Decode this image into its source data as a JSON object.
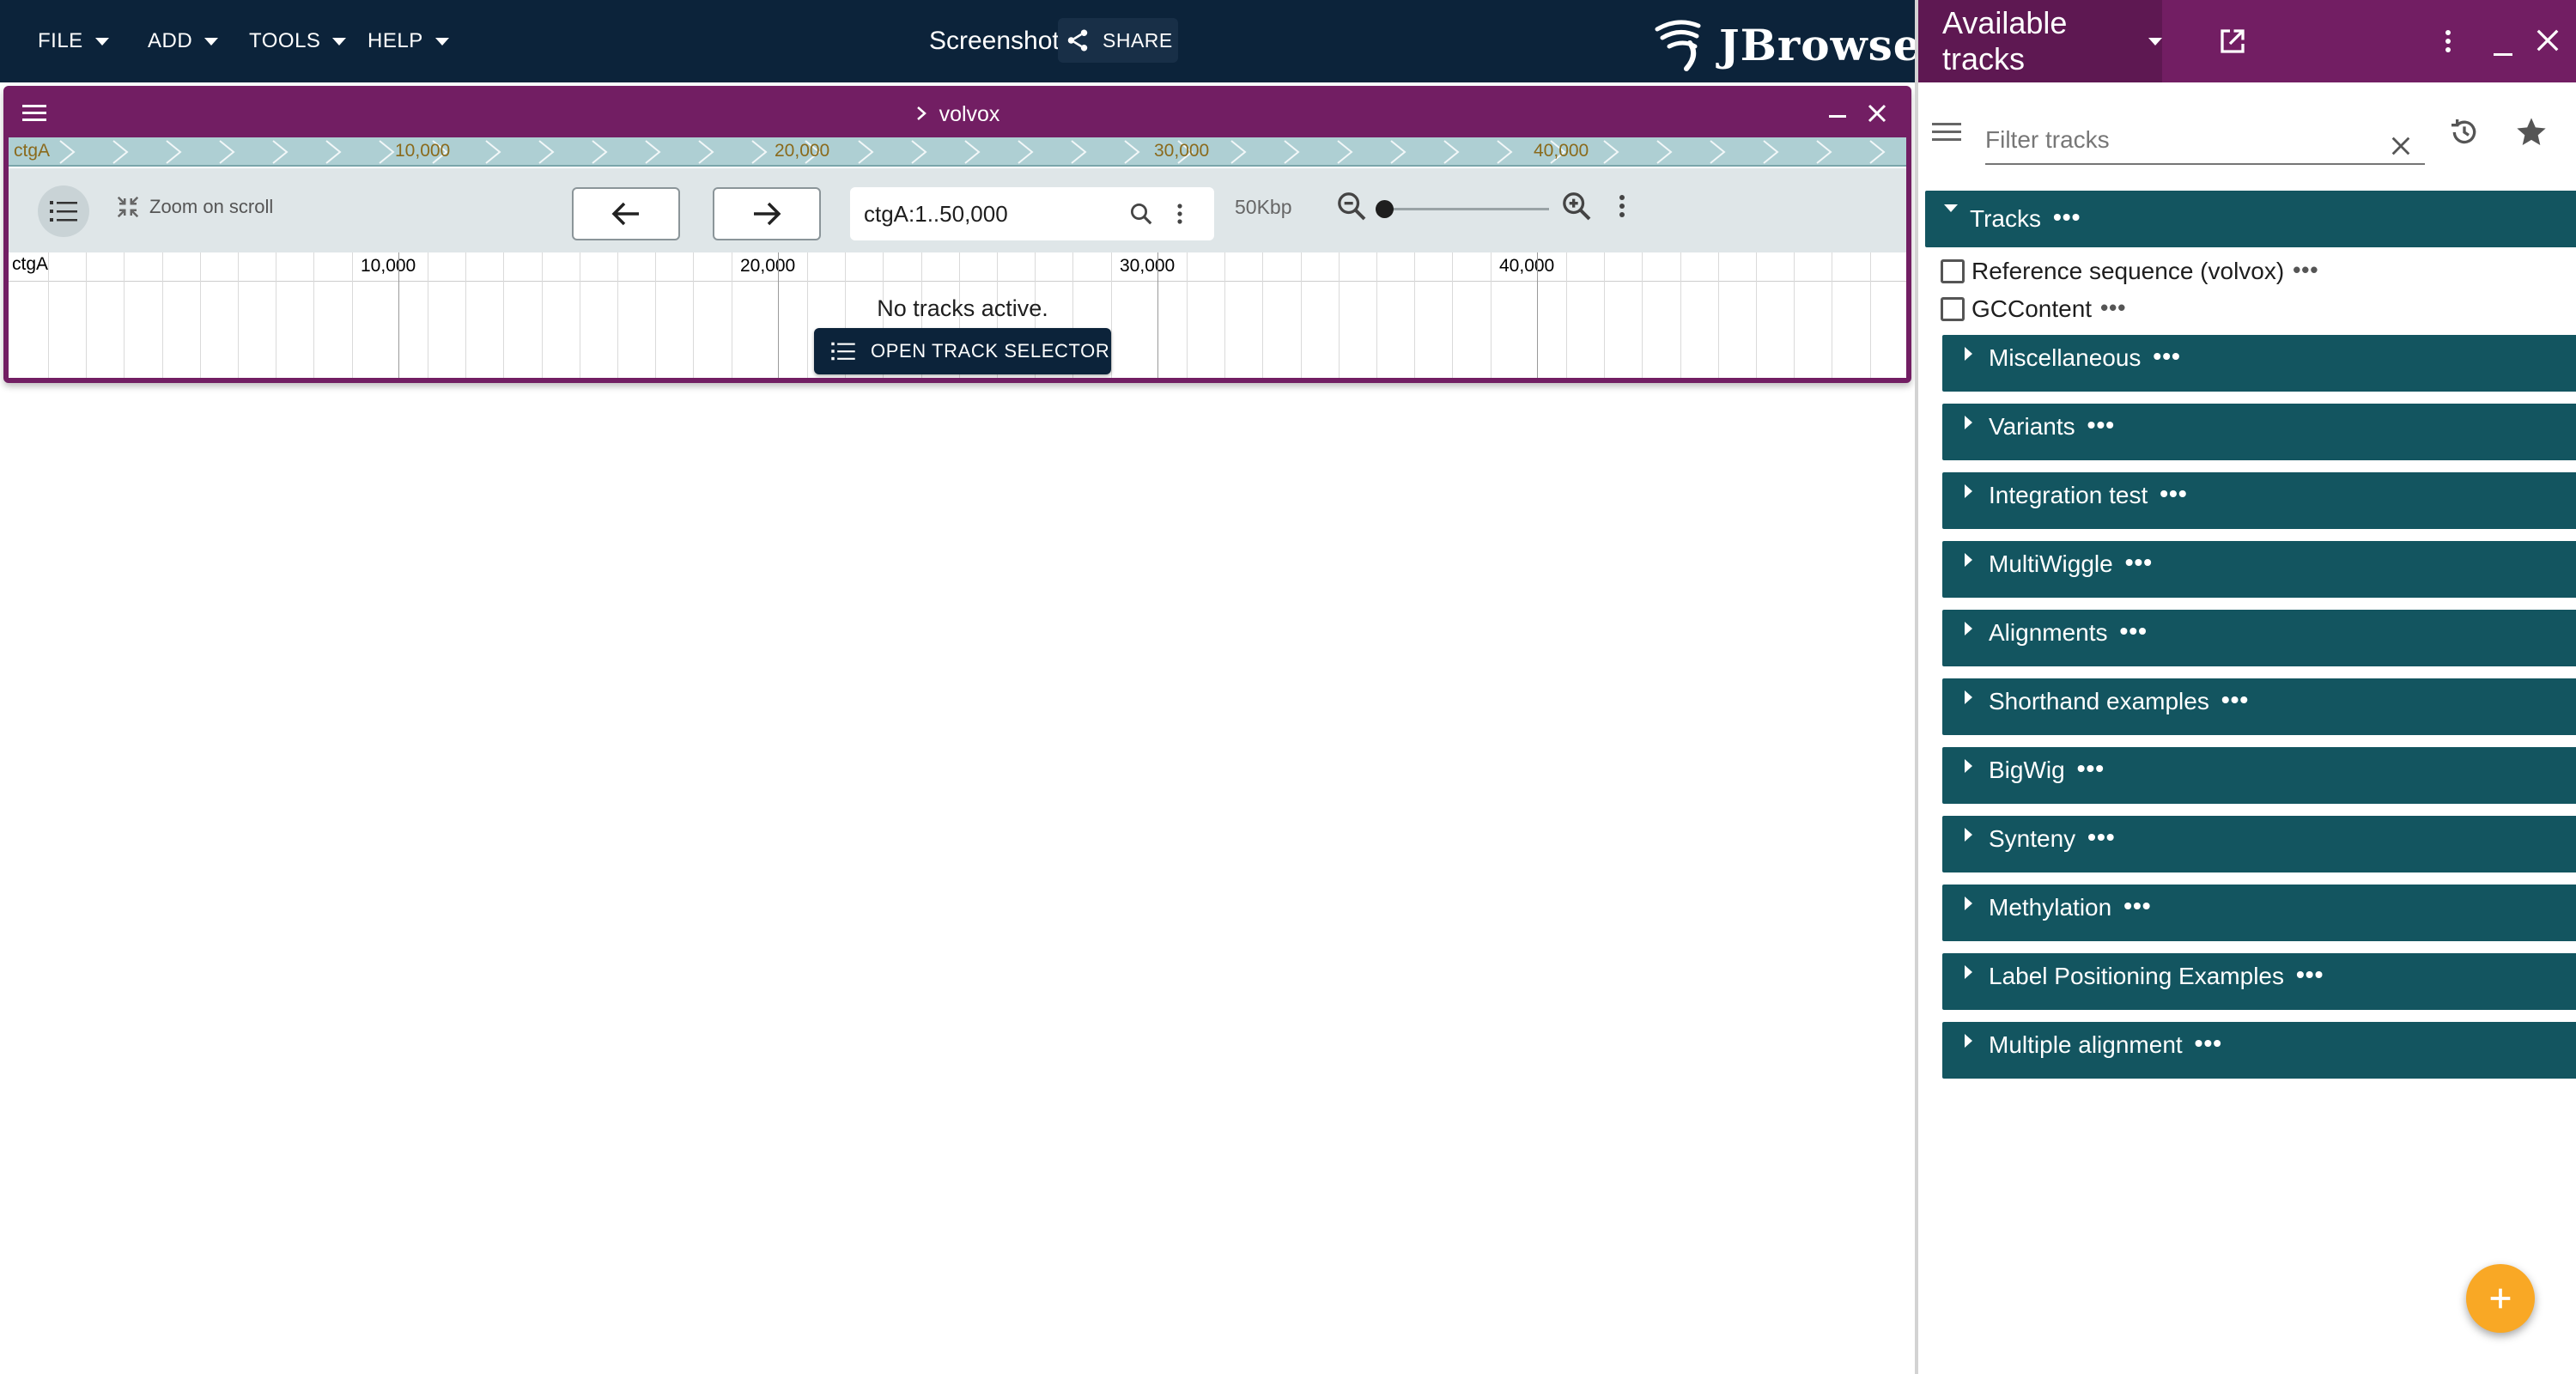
{
  "menu": {
    "file": "FILE",
    "add": "ADD",
    "tools": "TOOLS",
    "help": "HELP"
  },
  "session": {
    "name": "Screenshot",
    "share_label": "SHARE"
  },
  "logo": {
    "text": "JBrowse"
  },
  "view": {
    "assembly_title": "volvox",
    "overview_ref": "ctgA",
    "overview_ticks": [
      "10,000",
      "20,000",
      "30,000",
      "40,000"
    ],
    "zoom_on_scroll": "Zoom on scroll",
    "location": "ctgA:1..50,000",
    "bp_per_view": "50Kbp",
    "zoom_level": 0.03,
    "ruler_ref": "ctgA",
    "ruler_ticks": [
      "10,000",
      "20,000",
      "30,000",
      "40,000"
    ],
    "no_tracks": "No tracks active.",
    "open_track_selector": "OPEN TRACK SELECTOR"
  },
  "drawer": {
    "title": "Available tracks",
    "filter_placeholder": "Filter tracks",
    "root_category": "Tracks",
    "tracks": [
      "Reference sequence (volvox)",
      "GCContent"
    ],
    "categories": [
      "Miscellaneous",
      "Variants",
      "Integration test",
      "MultiWiggle",
      "Alignments",
      "Shorthand examples",
      "BigWig",
      "Synteny",
      "Methylation",
      "Label Positioning Examples",
      "Multiple alignment"
    ],
    "more_glyph": "•••"
  },
  "colors": {
    "appbar": "#0c233a",
    "primary": "#721e63",
    "category": "#135560",
    "overview": "#aecfd3",
    "fab": "#f9a825"
  }
}
